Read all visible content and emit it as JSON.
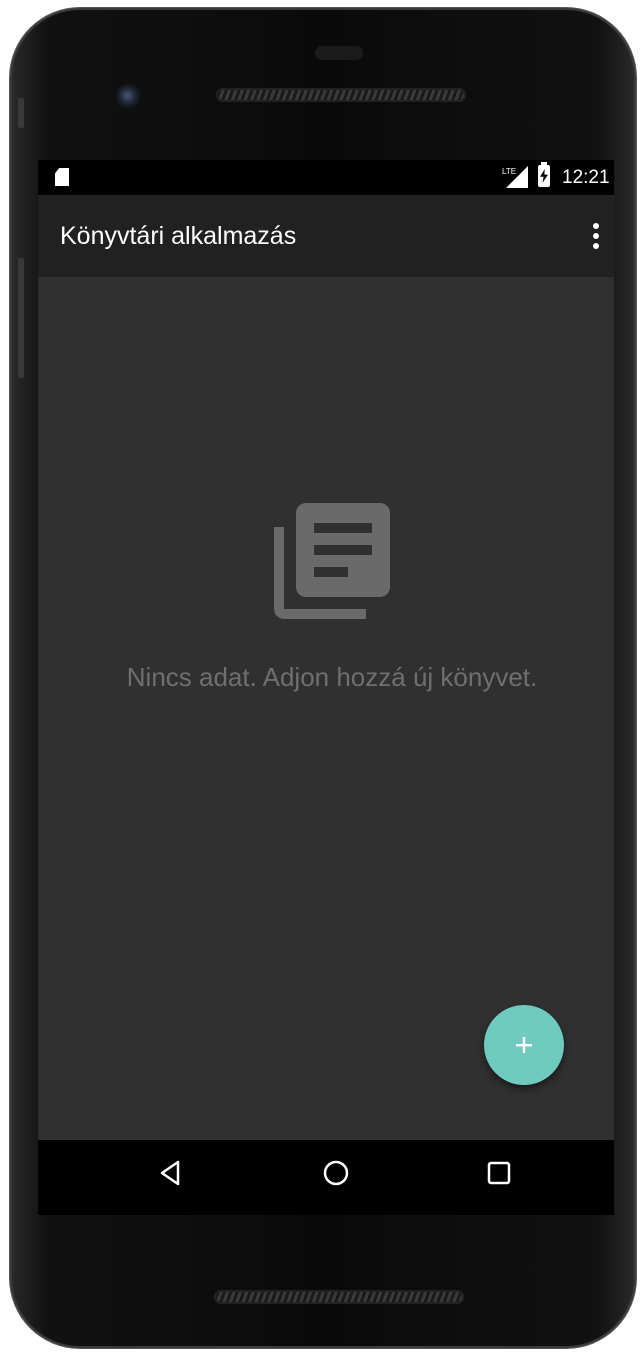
{
  "status_bar": {
    "time": "12:21",
    "network_label": "LTE",
    "icons": [
      "sd-card-icon",
      "network-signal-icon",
      "battery-charging-icon"
    ]
  },
  "app_bar": {
    "title": "Könyvtári alkalmazás",
    "menu_icon": "overflow-menu-icon"
  },
  "empty_state": {
    "icon": "library-books-icon",
    "message": "Nincs adat. Adjon hozzá új könyvet."
  },
  "fab": {
    "icon": "plus-icon"
  },
  "nav_bar": {
    "buttons": [
      "back-icon",
      "home-icon",
      "recents-icon"
    ]
  },
  "colors": {
    "app_bar": "#212121",
    "content_background": "#303030",
    "empty_text": "#6f6f6f",
    "empty_icon": "#6a6a6a",
    "fab": "#6fcac0"
  }
}
